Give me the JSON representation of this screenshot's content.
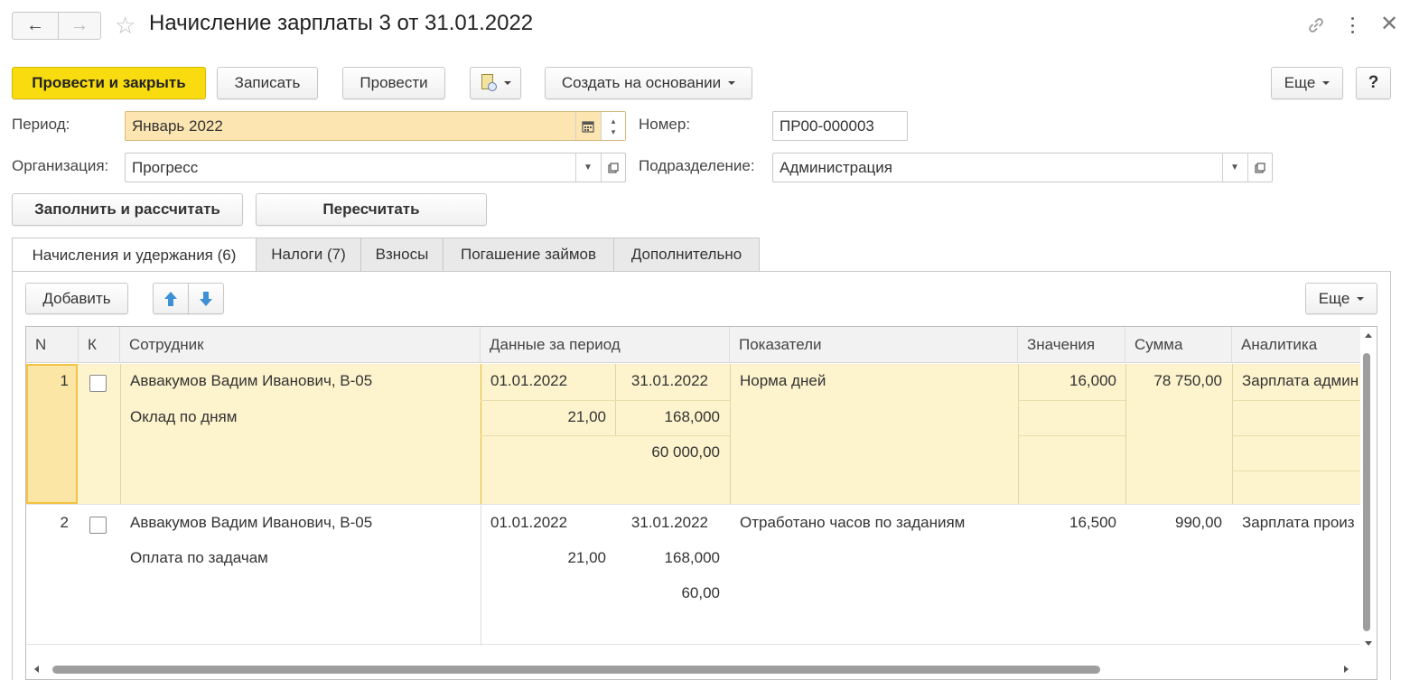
{
  "window": {
    "title": "Начисление зарплаты 3 от 31.01.2022",
    "icons": [
      "back-arrow-icon",
      "forward-arrow-icon",
      "star-icon",
      "link-icon",
      "more-vertical-icon",
      "close-icon"
    ]
  },
  "toolbar": {
    "post_close": "Провести и закрыть",
    "save": "Записать",
    "post": "Провести",
    "create_based": "Создать на основании",
    "more": "Еще",
    "help": "?"
  },
  "form": {
    "period_label": "Период:",
    "period_value": "Январь 2022",
    "number_label": "Номер:",
    "number_value": "ПР00-000003",
    "org_label": "Организация:",
    "org_value": "Прогресс",
    "dept_label": "Подразделение:",
    "dept_value": "Администрация"
  },
  "actions": {
    "fill_calc": "Заполнить и рассчитать",
    "recalc": "Пересчитать"
  },
  "tabs": [
    {
      "label": "Начисления и удержания (6)",
      "active": true
    },
    {
      "label": "Налоги (7)",
      "active": false
    },
    {
      "label": "Взносы",
      "active": false
    },
    {
      "label": "Погашение займов",
      "active": false
    },
    {
      "label": "Дополнительно",
      "active": false
    }
  ],
  "table_toolbar": {
    "add": "Добавить",
    "more": "Еще"
  },
  "table": {
    "columns": [
      "N",
      "К",
      "Сотрудник",
      "Данные за период",
      "Показатели",
      "Значения",
      "Сумма",
      "Аналитика"
    ],
    "rows": [
      {
        "n": "1",
        "employee": "Аввакумов Вадим Иванович, В-05",
        "accrual": "Оклад по дням",
        "date_from": "01.01.2022",
        "date_to": "31.01.2022",
        "days": "21,00",
        "hours": "168,000",
        "base": "60 000,00",
        "indicator": "Норма дней",
        "value": "16,000",
        "sum": "78 750,00",
        "analytics": "Зарплата админ",
        "selected": true
      },
      {
        "n": "2",
        "employee": "Аввакумов Вадим Иванович, В-05",
        "accrual": "Оплата по задачам",
        "date_from": "01.01.2022",
        "date_to": "31.01.2022",
        "days": "21,00",
        "hours": "168,000",
        "base": "60,00",
        "indicator": "Отработано часов по заданиям",
        "value": "16,500",
        "sum": "990,00",
        "analytics": "Зарплата произ",
        "selected": false
      }
    ]
  },
  "colors": {
    "primary": "#f9dc10",
    "period_bg": "#fce5b0",
    "selected_row": "#fdf3cc",
    "scroll_thumb": "#9e9e9e"
  }
}
